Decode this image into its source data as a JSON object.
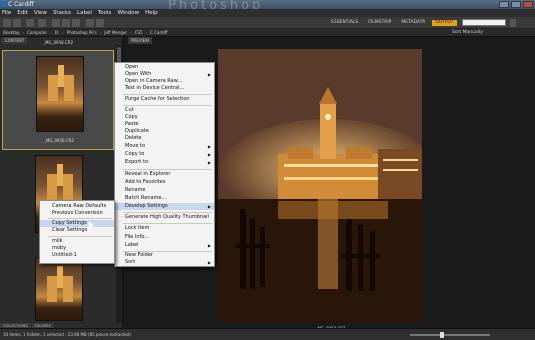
{
  "window": {
    "title": "C Cardiff",
    "watermark": "Photoshop"
  },
  "menubar": [
    "File",
    "Edit",
    "View",
    "Stacks",
    "Label",
    "Tools",
    "Window",
    "Help"
  ],
  "toolbar": {
    "workspaces": [
      "ESSENTIALS",
      "FILMSTRIP",
      "METADATA",
      "OUTPUT"
    ],
    "active_workspace": "OUTPUT",
    "search_placeholder": ""
  },
  "pathbar": {
    "crumbs": [
      "Desktop",
      "Computer",
      "D:",
      "Photoshop Pics",
      "Jeff Menger",
      "CS5",
      "C Cardiff"
    ],
    "sort_label": "Sort Manually"
  },
  "left_panel": {
    "tabs": [
      "CONTENT"
    ],
    "bottom_tabs": [
      "COLLECTIONS",
      "FOLDERS"
    ],
    "selected_thumb_label": "_MG_0958.CR2",
    "top_partial_label": "_MG_0958.CR2"
  },
  "preview": {
    "tab": "PREVIEW",
    "file_label": "_MG_0958.CR2"
  },
  "statusbar": {
    "text": "10 items, 1 hidden, 1 selected - 23.98 MB (85 pieces extracted)"
  },
  "context_menu": {
    "items": [
      "Open",
      "Open With",
      "Open in Camera Raw...",
      "Test in Device Central...",
      "Purge Cache for Selection",
      "Cut",
      "Copy",
      "Paste",
      "Duplicate",
      "Delete",
      "Move to",
      "Copy to",
      "Export to",
      "Reveal in Explorer",
      "Add to Favorites",
      "Rename",
      "Batch Rename...",
      "Develop Settings",
      "Generate High Quality Thumbnail",
      "Lock Item",
      "File Info...",
      "Label",
      "New Folder",
      "Sort"
    ]
  },
  "develop_submenu": {
    "items": [
      "Camera Raw Defaults",
      "Previous Conversion",
      "Copy Settings",
      "Clear Settings",
      "milk",
      "moby",
      "Untitled-1"
    ]
  },
  "colors": {
    "accent_workspace": "#e0a020",
    "menu_highlight": "#c8d7ec",
    "selection_border": "#b7a54d"
  }
}
